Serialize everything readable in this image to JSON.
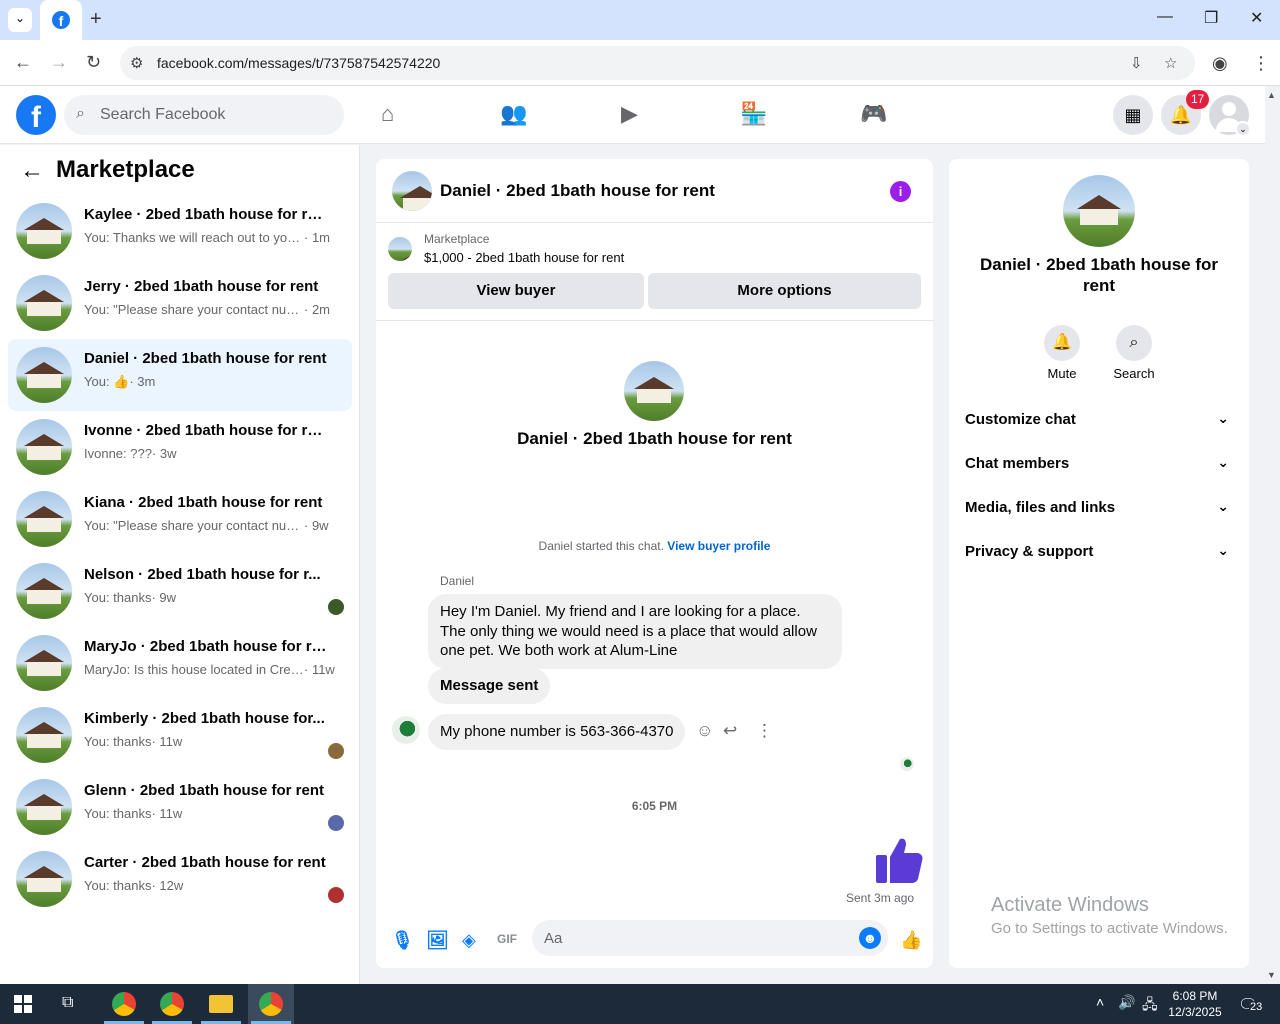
{
  "browser": {
    "url": "facebook.com/messages/t/737587542574220"
  },
  "header": {
    "search_placeholder": "Search Facebook",
    "notification_count": "17"
  },
  "sidebar": {
    "title": "Marketplace",
    "conversations": [
      {
        "name": "Kaylee · 2bed 1bath house for rent",
        "snippet": "You: Thanks we will reach out to you ...",
        "time": "· 1m"
      },
      {
        "name": "Jerry · 2bed 1bath house for rent",
        "snippet": "You: \"Please share your contact num...",
        "time": "· 2m"
      },
      {
        "name": "Daniel · 2bed 1bath house for rent",
        "snippet": "You: 👍",
        "time": "· 3m"
      },
      {
        "name": "Ivonne · 2bed 1bath house for rent",
        "snippet": "Ivonne: ???",
        "time": "· 3w"
      },
      {
        "name": "Kiana · 2bed 1bath house for rent",
        "snippet": "You: \"Please share your contact numb...",
        "time": "· 9w"
      },
      {
        "name": "Nelson · 2bed 1bath house for r...",
        "snippet": "You: thanks",
        "time": "· 9w"
      },
      {
        "name": "MaryJo · 2bed 1bath house for rent",
        "snippet": "MaryJo: Is this house located in Cres...",
        "time": "· 11w"
      },
      {
        "name": "Kimberly · 2bed 1bath house for...",
        "snippet": "You: thanks",
        "time": "· 11w"
      },
      {
        "name": "Glenn · 2bed 1bath house for rent",
        "snippet": "You: thanks",
        "time": "· 11w"
      },
      {
        "name": "Carter · 2bed 1bath house for rent",
        "snippet": "You: thanks",
        "time": "· 12w"
      }
    ]
  },
  "chat": {
    "title": "Daniel · 2bed 1bath house for rent",
    "marketplace_label": "Marketplace",
    "listing": "$1,000 - 2bed 1bath house for rent",
    "view_buyer": "View buyer",
    "more_options": "More options",
    "started_text": "Daniel started this chat.",
    "buyer_profile_link": "View buyer profile",
    "sender": "Daniel",
    "messages": [
      "Hey I'm Daniel. My friend and I are looking for a place. The only thing we would need is a place that would allow one pet. We both work at Alum-Line",
      "Message sent",
      "My phone number is 563-366-4370"
    ],
    "timestamp": "6:05 PM",
    "sent_status": "Sent 3m ago",
    "composer_placeholder": "Aa"
  },
  "details": {
    "name": "Daniel · 2bed 1bath house for rent",
    "mute_label": "Mute",
    "search_label": "Search",
    "sections": [
      "Customize chat",
      "Chat members",
      "Media, files and links",
      "Privacy & support"
    ]
  },
  "watermark": {
    "title": "Activate Windows",
    "subtitle": "Go to Settings to activate Windows."
  },
  "taskbar": {
    "time": "6:08 PM",
    "date": "12/3/2025",
    "notif_count": "23"
  }
}
